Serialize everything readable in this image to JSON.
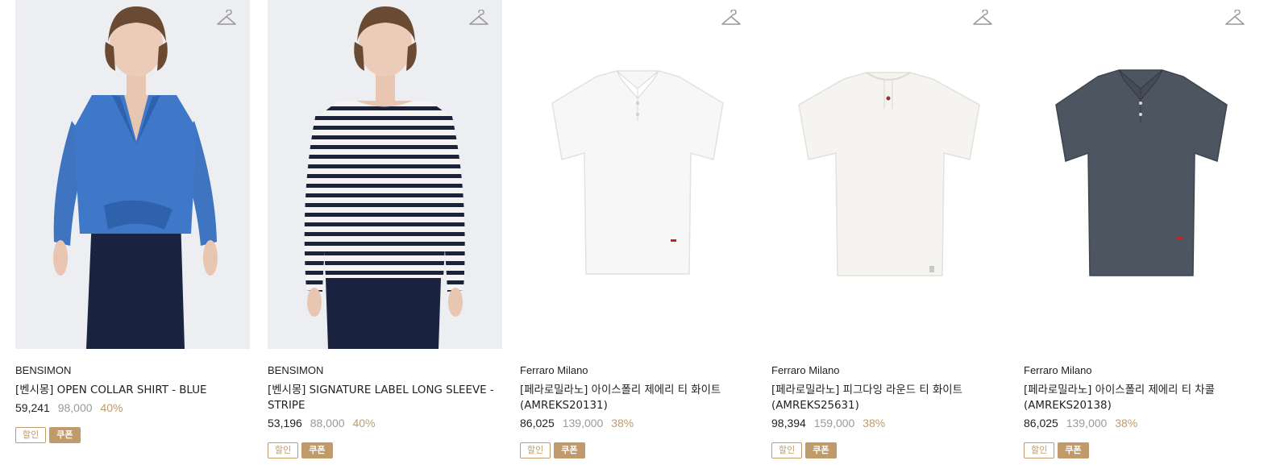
{
  "products": [
    {
      "brand": "BENSIMON",
      "name": "[벤시몽] OPEN COLLAR SHIRT - BLUE",
      "price": "59,241",
      "original_price": "98,000",
      "discount": "40%",
      "badge_sale": "할인",
      "badge_coupon": "쿠폰",
      "image": "model-blue-shirt"
    },
    {
      "brand": "BENSIMON",
      "name": "[벤시몽] SIGNATURE LABEL LONG SLEEVE - STRIPE",
      "price": "53,196",
      "original_price": "88,000",
      "discount": "40%",
      "badge_sale": "할인",
      "badge_coupon": "쿠폰",
      "image": "model-stripe-longsleeve"
    },
    {
      "brand": "Ferraro Milano",
      "name": "[페라로밀라노] 아이스폴리 제에리 티 화이트 (AMREKS20131)",
      "price": "86,025",
      "original_price": "139,000",
      "discount": "38%",
      "badge_sale": "할인",
      "badge_coupon": "쿠폰",
      "image": "white-polo"
    },
    {
      "brand": "Ferraro Milano",
      "name": "[페라로밀라노] 피그다잉 라운드 티 화이트 (AMREKS25631)",
      "price": "98,394",
      "original_price": "159,000",
      "discount": "38%",
      "badge_sale": "할인",
      "badge_coupon": "쿠폰",
      "image": "white-henley-tee"
    },
    {
      "brand": "Ferraro Milano",
      "name": "[페라로밀라노] 아이스폴리 제에리 티 차콜 (AMREKS20138)",
      "price": "86,025",
      "original_price": "139,000",
      "discount": "38%",
      "badge_sale": "할인",
      "badge_coupon": "쿠폰",
      "image": "charcoal-polo"
    }
  ],
  "icons": {
    "wishlist": "hanger-icon"
  },
  "colors": {
    "accent": "#c19a6b",
    "muted_price": "#9a9a9a",
    "text": "#222222"
  }
}
